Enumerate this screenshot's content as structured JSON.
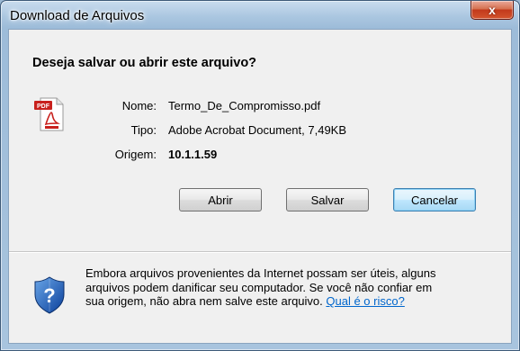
{
  "window": {
    "title": "Download de Arquivos",
    "close_symbol": "x"
  },
  "dialog": {
    "question": "Deseja salvar ou abrir este arquivo?",
    "file_icon": "pdf-document-icon",
    "file_icon_label": "PDF",
    "fields": [
      {
        "label": "Nome:",
        "value": "Termo_De_Compromisso.pdf"
      },
      {
        "label": "Tipo:",
        "value": "Adobe Acrobat Document, 7,49KB"
      },
      {
        "label": "Origem:",
        "value": "10.1.1.59"
      }
    ],
    "buttons": {
      "open": "Abrir",
      "save": "Salvar",
      "cancel": "Cancelar"
    }
  },
  "warning": {
    "icon": "security-shield-question-icon",
    "line1": "Embora arquivos provenientes da Internet possam ser úteis, alguns",
    "line2": "arquivos podem danificar seu computador. Se você não confiar em",
    "line3": "sua origem, não abra nem salve este arquivo.",
    "link": "Qual é o risco?"
  },
  "colors": {
    "titlebar": "#a8c4de",
    "close_button": "#c2391b",
    "link": "#0066cc",
    "default_button_border": "#3c7fb1"
  }
}
